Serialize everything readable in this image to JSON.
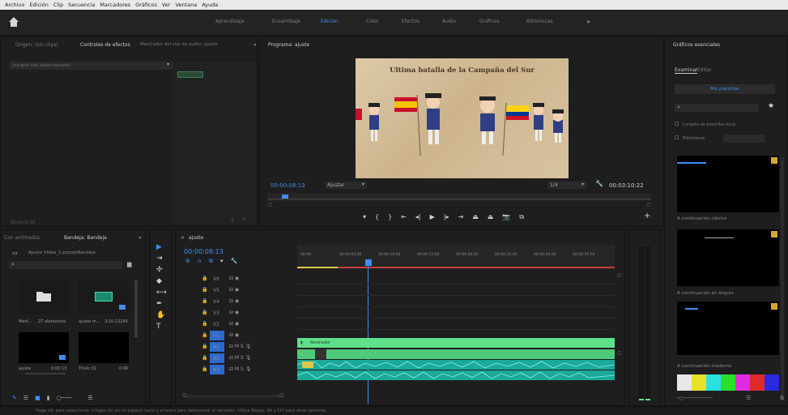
{
  "menu": [
    "Archivo",
    "Edición",
    "Clip",
    "Secuencia",
    "Marcadores",
    "Gráficos",
    "Ver",
    "Ventana",
    "Ayuda"
  ],
  "workspaces": [
    {
      "label": "Aprendizaje",
      "active": false
    },
    {
      "label": "Ensamblaje",
      "active": false
    },
    {
      "label": "Edición",
      "active": true
    },
    {
      "label": "Color",
      "active": false
    },
    {
      "label": "Efectos",
      "active": false
    },
    {
      "label": "Audio",
      "active": false
    },
    {
      "label": "Gráficos",
      "active": false
    },
    {
      "label": "Bibliotecas",
      "active": false
    }
  ],
  "source_panel": {
    "tabs": [
      "Origen: (sin clips)",
      "Controles de efectos",
      "Mezclador del clip de audio: ajuste"
    ],
    "clip_select": "(ningún clip seleccionado)",
    "timecode": "00:00:00:00"
  },
  "program": {
    "tab": "Programa: ajuste",
    "video_title": "Ultima batalla de la Campaña del Sur",
    "timecode": "00:00:08:13",
    "fit": "Ajustar",
    "resolution": "1/4",
    "duration": "00:03:10:22"
  },
  "project": {
    "tabs": [
      "Con arrimados",
      "Bandeja: Bandeja"
    ],
    "path": "Ajuste Video_1.prproj\\Bandeja",
    "items": [
      {
        "name": "Medi...",
        "meta": "27 elementos"
      },
      {
        "name": "ajuste m...",
        "meta": "3:10:22243"
      },
      {
        "name": "ajuste",
        "meta": "0:00:13"
      },
      {
        "name": "Título 01",
        "meta": "0:00"
      }
    ]
  },
  "timeline": {
    "tab": "ajuste",
    "timecode": "00:00:08:13",
    "ruler": [
      "00:00",
      "00:00:05:00",
      "00:00:10:00",
      "00:00:15:00",
      "00:00:20:00",
      "00:00:25:00",
      "00:00:30:00",
      "00:00:35:00"
    ],
    "tracks": [
      "V6",
      "V5",
      "V4",
      "V3",
      "V2",
      "V1",
      "A1",
      "A2",
      "A3"
    ],
    "clip_title": "Revelador"
  },
  "graphics": {
    "tab": "Gráficos esenciales",
    "subtabs": [
      "Examinar",
      "Editar"
    ],
    "dropdown": "Mis plantillas",
    "checkboxes": [
      "Carpeta de plantillas local",
      "Bibliotecas"
    ],
    "templates": [
      "A continuación clásico",
      "A continuación en ángulo",
      "A continuación moderno"
    ]
  },
  "status": "Haga clic para seleccionar, o haga clic en un espacio vacío y arrastre para seleccionar el recuadro. Utilice Mayús, Alt y Ctrl para otras opciones.",
  "colors": {
    "accent": "#3f8cf5",
    "video_clip": "#5fe08a",
    "audio_clip": "#1ba99a"
  }
}
